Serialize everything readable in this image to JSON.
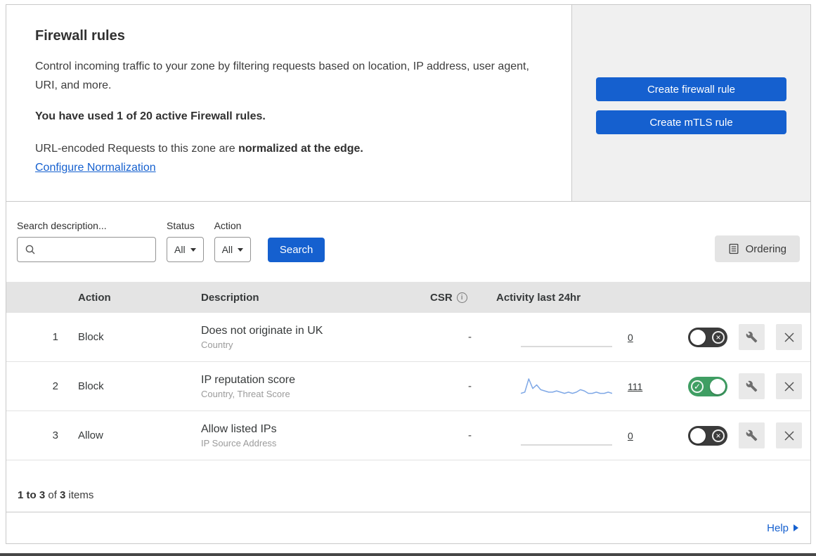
{
  "colors": {
    "accent_blue": "#1560cf",
    "toggle_on": "#3f9e63",
    "toggle_off": "#3b3b3b",
    "sparkline_active": "#7fa8e6",
    "sparkline_flat": "#cdcdcd"
  },
  "icons": {
    "check": "✓",
    "cross": "×",
    "info": "i"
  },
  "header": {
    "title": "Firewall rules",
    "description": "Control incoming traffic to your zone by filtering requests based on location, IP address, user agent, URI, and more.",
    "usage": "You have used 1 of 20 active Firewall rules.",
    "normalization_prefix": "URL-encoded Requests to this zone are ",
    "normalization_bold": "normalized at the edge.",
    "normalization_link": "Configure Normalization",
    "create_firewall_button": "Create firewall rule",
    "create_mtls_button": "Create mTLS rule"
  },
  "filters": {
    "search_label": "Search description...",
    "search_value": "",
    "status_label": "Status",
    "status_value": "All",
    "action_label": "Action",
    "action_value": "All",
    "search_button": "Search",
    "ordering_button": "Ordering"
  },
  "table": {
    "columns": {
      "action": "Action",
      "description": "Description",
      "csr": "CSR",
      "activity": "Activity last 24hr"
    },
    "rows": [
      {
        "index": "1",
        "action": "Block",
        "description": "Does not originate in UK",
        "subtitle": "Country",
        "csr": "-",
        "activity_count": "0",
        "enabled": false,
        "activity_series": [
          0,
          0,
          0,
          0,
          0,
          0,
          0,
          0,
          0,
          0,
          0,
          0,
          0,
          0,
          0,
          0,
          0,
          0,
          0,
          0,
          0,
          0,
          0,
          0
        ]
      },
      {
        "index": "2",
        "action": "Block",
        "description": "IP reputation score",
        "subtitle": "Country, Threat Score",
        "csr": "-",
        "activity_count": "111",
        "enabled": true,
        "activity_series": [
          2,
          3,
          14,
          6,
          9,
          5,
          4,
          3,
          3,
          4,
          3,
          2,
          3,
          2,
          3,
          5,
          4,
          2,
          2,
          3,
          2,
          2,
          3,
          2
        ]
      },
      {
        "index": "3",
        "action": "Allow",
        "description": "Allow listed IPs",
        "subtitle": "IP Source Address",
        "csr": "-",
        "activity_count": "0",
        "enabled": false,
        "activity_series": [
          0,
          0,
          0,
          0,
          0,
          0,
          0,
          0,
          0,
          0,
          0,
          0,
          0,
          0,
          0,
          0,
          0,
          0,
          0,
          0,
          0,
          0,
          0,
          0
        ]
      }
    ],
    "footer": {
      "range": "1 to 3",
      "of": " of ",
      "total": "3",
      "items": " items"
    }
  },
  "help": {
    "label": "Help"
  }
}
